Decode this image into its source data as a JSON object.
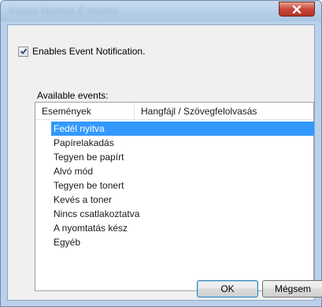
{
  "window": {
    "title": "Status Monitor Értesítés",
    "close_label": "x"
  },
  "notification": {
    "checkbox_checked": true,
    "label": "Enables Event Notification."
  },
  "events": {
    "label": "Available events:",
    "columns": [
      "Események",
      "Hangfájl / Szövegfelolvasás"
    ],
    "items": [
      "Fedél nyitva",
      "Papírelakadás",
      "Tegyen be papírt",
      "Alvó mód",
      "Tegyen be tonert",
      "Kevés a toner",
      "Nincs csatlakoztatva",
      "A nyomtatás kész",
      "Egyéb"
    ],
    "selected_index": 0
  },
  "buttons": {
    "ok": "OK",
    "cancel": "Mégsem"
  },
  "colors": {
    "selection": "#3399ff",
    "titlebar": "#b9d1ea",
    "close_button": "#c9483a"
  }
}
